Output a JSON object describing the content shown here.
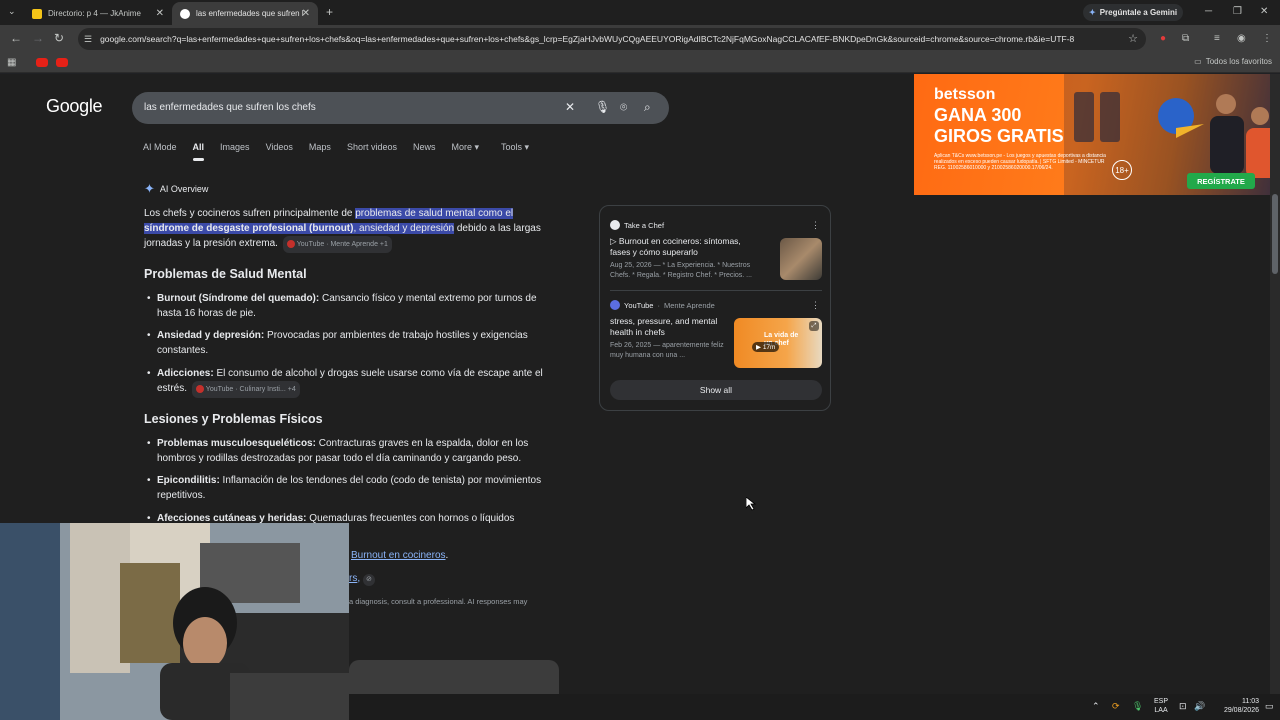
{
  "tabs": [
    {
      "title": "Directorio: p 4 — JkAnime",
      "active": false
    },
    {
      "title": "las enfermedades que sufren lo",
      "active": true
    }
  ],
  "gemini_label": "Pregúntale a Gemini",
  "url": "google.com/search?q=las+enfermedades+que+sufren+los+chefs&oq=las+enfermedades+que+sufren+los+chefs&gs_lcrp=EgZjaHJvbWUyCQgAEEUYORigAdIBCTc2NjFqMGoxNagCCLACAfEF-BNKDpeDnGk&sourceid=chrome&source=chrome.rb&ie=UTF-8",
  "all_bookmarks": "Todos los favoritos",
  "logo": "Google",
  "query": "las enfermedades que sufren los chefs",
  "filters": [
    "AI Mode",
    "All",
    "Images",
    "Videos",
    "Maps",
    "Short videos",
    "News",
    "More ▾",
    "Tools ▾"
  ],
  "ai_overview": {
    "heading": "AI Overview",
    "intro_a": "Los chefs y cocineros sufren principalmente de ",
    "intro_hl1": "problemas de salud mental como el",
    "intro_hl2": "síndrome de desgaste profesional (burnout)",
    "intro_hl3": ", ansiedad y depresión",
    "intro_b": " debido a las largas jornadas y la presión extrema.",
    "intro_cite": "YouTube · Mente Aprende +1",
    "sec1": "Problemas de Salud Mental",
    "b1_title": "Burnout (Síndrome del quemado):",
    "b1_text": " Cansancio físico y mental extremo por turnos de hasta 16 horas de pie.",
    "b2_title": "Ansiedad y depresión:",
    "b2_text": " Provocadas por ambientes de trabajo hostiles y exigencias constantes.",
    "b3_title": "Adicciones:",
    "b3_text": " El consumo de alcohol y drogas suele usarse como vía de escape ante el estrés.",
    "b3_cite": "YouTube · Culinary Insti... +4",
    "sec2": "Lesiones y Problemas Físicos",
    "b4_title": "Problemas musculoesqueléticos:",
    "b4_text": " Contracturas graves en la espalda, dolor en los hombros y rodillas destrozadas por pasar todo el día caminando y cargando peso.",
    "b5_title": "Epicondilitis:",
    "b5_text": " Inflamación de los tendones del codo (codo de tenista) por movimientos repetitivos.",
    "b6_title": "Afecciones cutáneas y heridas:",
    "b6_text": " Quemaduras frecuentes con hornos o líquidos",
    "link_text": "Burnout en cocineros",
    "link_tail": ".",
    "partial_link": "rs",
    "disclaimer": "a diagnosis, consult a professional. AI responses may"
  },
  "sources": [
    {
      "site": "Take a Chef",
      "title": "▷ Burnout en cocineros: síntomas, fases y cómo superarlo",
      "snippet": "Aug 25, 2026 — * La Experiencia. * Nuestros Chefs. * Regala. * Registro Chef. * Precios. ..."
    },
    {
      "site": "YouTube",
      "channel": "Mente Aprende",
      "title": "stress, pressure, and mental health in chefs",
      "snippet": "Feb 26, 2025 — aparentemente feliz muy humana con una ...",
      "duration": "17m",
      "thumb_text": "La vida de un chef"
    }
  ],
  "show_all": "Show all",
  "ad": {
    "brand": "betsson",
    "headline_1": "GANA 300",
    "headline_2": "GIROS GRATIS",
    "fine_print": "Aplican T&Cs www.betsson.pe - Los juegos y apuestas deportivas a distancia realizados en exceso pueden causar ludopatía. | SFTG Limited - MINCETUR REG. 11002586010000 y 21002586020000.17/06/24.",
    "age": "18+",
    "cta": "REGÍSTRATE"
  },
  "taskbar": {
    "lang_1": "ESP",
    "lang_2": "LAA",
    "time": "11:03",
    "date": "29/08/2026"
  },
  "colors": {
    "highlight": "#3b4aa8",
    "link": "#8ab4f8",
    "ad_orange": "#ff6a13",
    "ad_cta": "#22a94a"
  }
}
